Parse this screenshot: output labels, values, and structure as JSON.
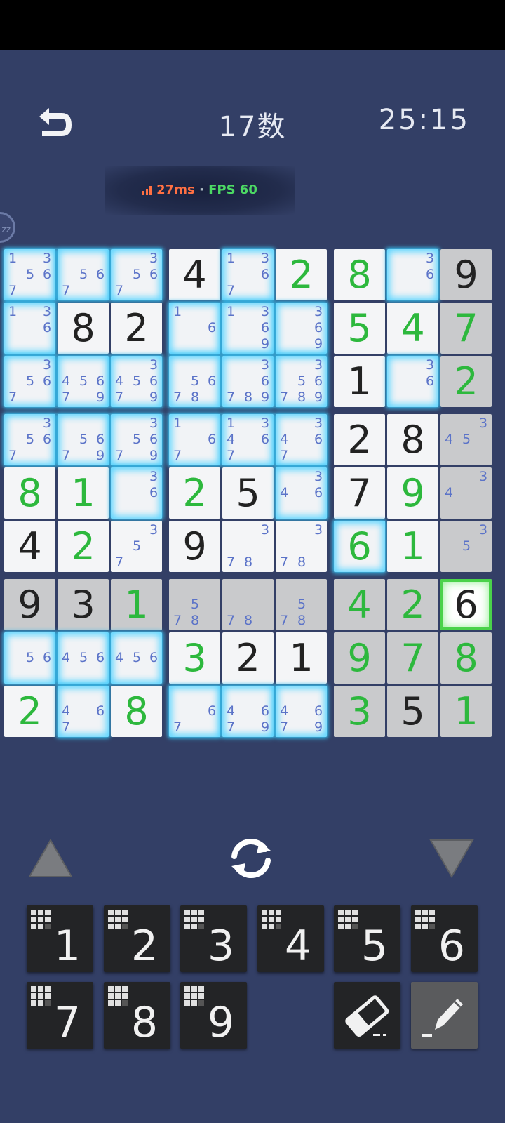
{
  "header": {
    "back_icon": "undo-arrow-icon",
    "title": "17数",
    "timer": "25:15"
  },
  "netstat": {
    "ping": "27ms",
    "separator": "·",
    "fps": "FPS 60",
    "ping_color": "#ff7043",
    "fps_color": "#4cd964"
  },
  "side_bubble": {
    "label": "zz"
  },
  "colors": {
    "background": "#333f66",
    "given_digit": "#222222",
    "user_digit": "#2db83d",
    "pencil_mark": "#5b73c8",
    "highlight_glow": "#37c0f0",
    "selected_border": "#4ad24a"
  },
  "board": {
    "rows": [
      [
        {
          "bg": "glow",
          "v": "",
          "t": "",
          "pm": [
            1,
            3,
            5,
            6,
            7
          ]
        },
        {
          "bg": "glow",
          "v": "",
          "t": "",
          "pm": [
            5,
            6,
            7
          ]
        },
        {
          "bg": "glow",
          "v": "",
          "t": "",
          "pm": [
            3,
            5,
            6,
            7
          ]
        },
        {
          "bg": "white",
          "v": "4",
          "t": "given",
          "pm": []
        },
        {
          "bg": "glow",
          "v": "",
          "t": "",
          "pm": [
            1,
            3,
            6,
            7
          ]
        },
        {
          "bg": "white",
          "v": "2",
          "t": "user",
          "pm": []
        },
        {
          "bg": "white",
          "v": "8",
          "t": "user",
          "pm": []
        },
        {
          "bg": "glow",
          "v": "",
          "t": "",
          "pm": [
            3,
            6
          ]
        },
        {
          "bg": "gray",
          "v": "9",
          "t": "given",
          "pm": []
        }
      ],
      [
        {
          "bg": "glow",
          "v": "",
          "t": "",
          "pm": [
            1,
            3,
            6
          ]
        },
        {
          "bg": "white",
          "v": "8",
          "t": "given",
          "pm": []
        },
        {
          "bg": "white",
          "v": "2",
          "t": "given",
          "pm": []
        },
        {
          "bg": "glow",
          "v": "",
          "t": "",
          "pm": [
            1,
            6
          ]
        },
        {
          "bg": "glow",
          "v": "",
          "t": "",
          "pm": [
            1,
            3,
            6,
            9
          ]
        },
        {
          "bg": "glow",
          "v": "",
          "t": "",
          "pm": [
            3,
            6,
            9
          ]
        },
        {
          "bg": "white",
          "v": "5",
          "t": "user",
          "pm": []
        },
        {
          "bg": "white",
          "v": "4",
          "t": "user",
          "pm": []
        },
        {
          "bg": "gray",
          "v": "7",
          "t": "user",
          "pm": []
        }
      ],
      [
        {
          "bg": "glow",
          "v": "",
          "t": "",
          "pm": [
            3,
            5,
            6,
            7
          ]
        },
        {
          "bg": "glow",
          "v": "",
          "t": "",
          "pm": [
            4,
            5,
            6,
            7,
            9
          ]
        },
        {
          "bg": "glow",
          "v": "",
          "t": "",
          "pm": [
            3,
            4,
            5,
            6,
            7,
            9
          ]
        },
        {
          "bg": "glow",
          "v": "",
          "t": "",
          "pm": [
            5,
            6,
            7,
            8
          ]
        },
        {
          "bg": "glow",
          "v": "",
          "t": "",
          "pm": [
            3,
            6,
            7,
            8,
            9
          ]
        },
        {
          "bg": "glow",
          "v": "",
          "t": "",
          "pm": [
            3,
            5,
            6,
            7,
            8,
            9
          ]
        },
        {
          "bg": "white",
          "v": "1",
          "t": "given",
          "pm": []
        },
        {
          "bg": "glow",
          "v": "",
          "t": "",
          "pm": [
            3,
            6
          ]
        },
        {
          "bg": "gray",
          "v": "2",
          "t": "user",
          "pm": []
        }
      ],
      [
        {
          "bg": "glow",
          "v": "",
          "t": "",
          "pm": [
            3,
            5,
            6,
            7
          ]
        },
        {
          "bg": "glow",
          "v": "",
          "t": "",
          "pm": [
            5,
            6,
            7,
            9
          ]
        },
        {
          "bg": "glow",
          "v": "",
          "t": "",
          "pm": [
            3,
            5,
            6,
            7,
            9
          ]
        },
        {
          "bg": "glow",
          "v": "",
          "t": "",
          "pm": [
            1,
            6,
            7
          ]
        },
        {
          "bg": "glow",
          "v": "",
          "t": "",
          "pm": [
            1,
            3,
            4,
            6,
            7
          ]
        },
        {
          "bg": "glow",
          "v": "",
          "t": "",
          "pm": [
            3,
            4,
            6,
            7
          ]
        },
        {
          "bg": "white",
          "v": "2",
          "t": "given",
          "pm": []
        },
        {
          "bg": "white",
          "v": "8",
          "t": "given",
          "pm": []
        },
        {
          "bg": "gray",
          "v": "",
          "t": "",
          "pm": [
            3,
            4,
            5
          ]
        }
      ],
      [
        {
          "bg": "white",
          "v": "8",
          "t": "user",
          "pm": []
        },
        {
          "bg": "white",
          "v": "1",
          "t": "user",
          "pm": []
        },
        {
          "bg": "glow",
          "v": "",
          "t": "",
          "pm": [
            3,
            6
          ]
        },
        {
          "bg": "white",
          "v": "2",
          "t": "user",
          "pm": []
        },
        {
          "bg": "white",
          "v": "5",
          "t": "given",
          "pm": []
        },
        {
          "bg": "glow",
          "v": "",
          "t": "",
          "pm": [
            3,
            4,
            6
          ]
        },
        {
          "bg": "white",
          "v": "7",
          "t": "given",
          "pm": []
        },
        {
          "bg": "white",
          "v": "9",
          "t": "user",
          "pm": []
        },
        {
          "bg": "gray",
          "v": "",
          "t": "",
          "pm": [
            3,
            4
          ]
        }
      ],
      [
        {
          "bg": "white",
          "v": "4",
          "t": "given",
          "pm": []
        },
        {
          "bg": "white",
          "v": "2",
          "t": "user",
          "pm": []
        },
        {
          "bg": "white",
          "v": "",
          "t": "",
          "pm": [
            3,
            5,
            7
          ]
        },
        {
          "bg": "white",
          "v": "9",
          "t": "given",
          "pm": []
        },
        {
          "bg": "white",
          "v": "",
          "t": "",
          "pm": [
            3,
            7,
            8
          ]
        },
        {
          "bg": "white",
          "v": "",
          "t": "",
          "pm": [
            3,
            7,
            8
          ]
        },
        {
          "bg": "glow",
          "v": "6",
          "t": "user",
          "pm": []
        },
        {
          "bg": "white",
          "v": "1",
          "t": "user",
          "pm": []
        },
        {
          "bg": "gray",
          "v": "",
          "t": "",
          "pm": [
            3,
            5
          ]
        }
      ],
      [
        {
          "bg": "gray",
          "v": "9",
          "t": "given",
          "pm": []
        },
        {
          "bg": "gray",
          "v": "3",
          "t": "given",
          "pm": []
        },
        {
          "bg": "gray",
          "v": "1",
          "t": "user",
          "pm": []
        },
        {
          "bg": "gray",
          "v": "",
          "t": "",
          "pm": [
            5,
            7,
            8
          ]
        },
        {
          "bg": "gray",
          "v": "",
          "t": "",
          "pm": [
            7,
            8
          ]
        },
        {
          "bg": "gray",
          "v": "",
          "t": "",
          "pm": [
            5,
            7,
            8
          ]
        },
        {
          "bg": "gray",
          "v": "4",
          "t": "user",
          "pm": []
        },
        {
          "bg": "gray",
          "v": "2",
          "t": "user",
          "pm": []
        },
        {
          "bg": "selected",
          "v": "6",
          "t": "given",
          "pm": []
        }
      ],
      [
        {
          "bg": "glow",
          "v": "",
          "t": "",
          "pm": [
            5,
            6
          ]
        },
        {
          "bg": "glow",
          "v": "",
          "t": "",
          "pm": [
            4,
            5,
            6
          ]
        },
        {
          "bg": "glow",
          "v": "",
          "t": "",
          "pm": [
            4,
            5,
            6
          ]
        },
        {
          "bg": "white",
          "v": "3",
          "t": "user",
          "pm": []
        },
        {
          "bg": "white",
          "v": "2",
          "t": "given",
          "pm": []
        },
        {
          "bg": "white",
          "v": "1",
          "t": "given",
          "pm": []
        },
        {
          "bg": "gray",
          "v": "9",
          "t": "user",
          "pm": []
        },
        {
          "bg": "gray",
          "v": "7",
          "t": "user",
          "pm": []
        },
        {
          "bg": "gray",
          "v": "8",
          "t": "user",
          "pm": []
        }
      ],
      [
        {
          "bg": "white",
          "v": "2",
          "t": "user",
          "pm": []
        },
        {
          "bg": "glow",
          "v": "",
          "t": "",
          "pm": [
            4,
            6,
            7
          ]
        },
        {
          "bg": "white",
          "v": "8",
          "t": "user",
          "pm": []
        },
        {
          "bg": "glow",
          "v": "",
          "t": "",
          "pm": [
            6,
            7
          ]
        },
        {
          "bg": "glow",
          "v": "",
          "t": "",
          "pm": [
            4,
            6,
            7,
            9
          ]
        },
        {
          "bg": "glow",
          "v": "",
          "t": "",
          "pm": [
            4,
            6,
            7,
            9
          ]
        },
        {
          "bg": "gray",
          "v": "3",
          "t": "user",
          "pm": []
        },
        {
          "bg": "gray",
          "v": "5",
          "t": "given",
          "pm": []
        },
        {
          "bg": "gray",
          "v": "1",
          "t": "user",
          "pm": []
        }
      ]
    ]
  },
  "controls": {
    "up_icon": "triangle-up-icon",
    "rotate_icon": "rotate-arrows-icon",
    "down_icon": "triangle-down-icon"
  },
  "keypad": {
    "digits": [
      "1",
      "2",
      "3",
      "4",
      "5",
      "6",
      "7",
      "8",
      "9"
    ],
    "remaining_icon": "dot-grid-icon",
    "eraser_icon": "eraser-icon",
    "pencil_icon": "pencil-icon"
  }
}
